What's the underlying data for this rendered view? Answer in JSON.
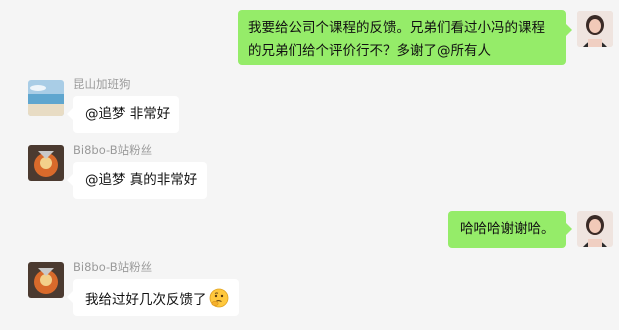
{
  "messages": [
    {
      "side": "right",
      "sender": "",
      "avatar": "woman-photo-avatar",
      "lines": [
        "我要给公司个课程的反馈。兄弟们看过小冯的课程",
        "的兄弟们给个评价行不？多谢了@所有人"
      ]
    },
    {
      "side": "left",
      "sender": "昆山加班狗",
      "avatar": "beach-photo-avatar",
      "lines": [
        "@追梦 非常好"
      ]
    },
    {
      "side": "left",
      "sender": "Bi8bo-B站粉丝",
      "avatar": "ultraman-avatar",
      "lines": [
        "@追梦 真的非常好"
      ]
    },
    {
      "side": "right",
      "sender": "",
      "avatar": "woman-photo-avatar",
      "lines": [
        "哈哈哈谢谢哈。"
      ]
    },
    {
      "side": "left",
      "sender": "Bi8bo-B站粉丝",
      "avatar": "ultraman-avatar",
      "lines": [
        "我给过好几次反馈了"
      ],
      "trailing_emoji": "thinking-face-emoji"
    }
  ],
  "colors": {
    "background": "#f5f5f5",
    "my_bubble": "#95ec69",
    "other_bubble": "#ffffff",
    "sender_name": "#9a9a9a"
  }
}
